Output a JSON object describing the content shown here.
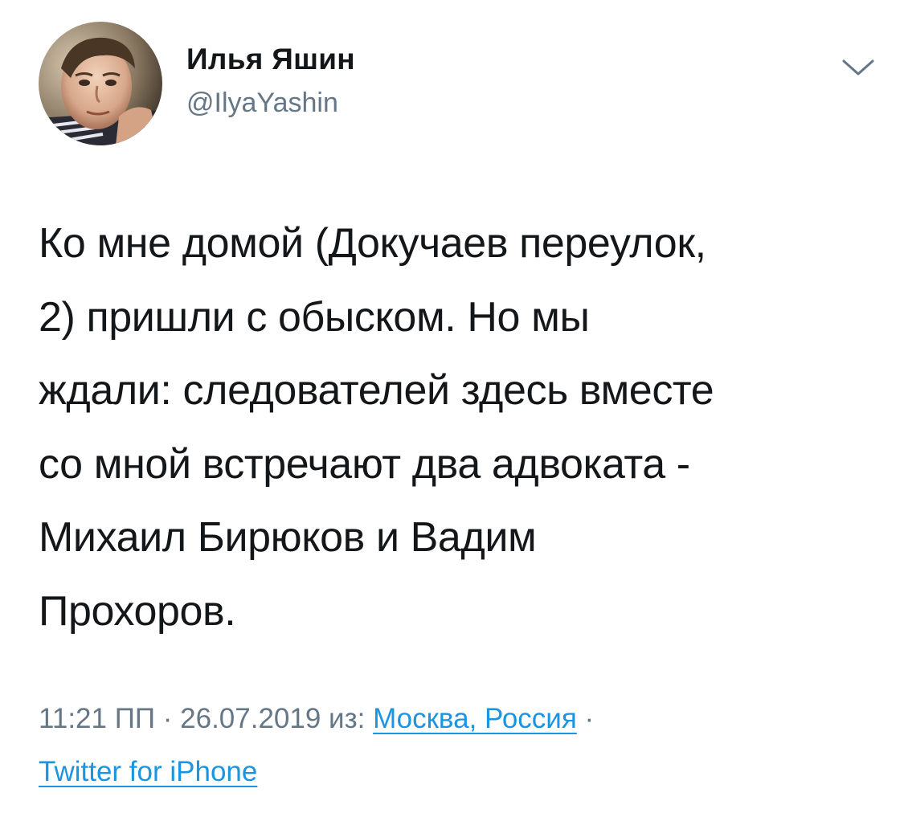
{
  "tweet": {
    "author": {
      "display_name": "Илья Яшин",
      "handle": "@IlyaYashin"
    },
    "text_lines": [
      "Ко мне домой (Докучаев переулок,",
      "2) пришли с обыском. Но мы",
      "ждали: следователей здесь вместе",
      "со мной встречают два адвоката -",
      "Михаил Бирюков и Вадим",
      "Прохоров."
    ],
    "meta": {
      "time": "11:21 ПП",
      "sep1": " · ",
      "date": "26.07.2019",
      "from_label": " из: ",
      "location": "Москва, Россия",
      "sep2": " ·",
      "source": "Twitter for iPhone"
    }
  },
  "colors": {
    "text_primary": "#14171a",
    "text_secondary": "#657786",
    "link": "#1b95e0",
    "background": "#ffffff"
  },
  "icons": {
    "caret": "chevron-down-icon",
    "avatar": "profile-photo"
  }
}
